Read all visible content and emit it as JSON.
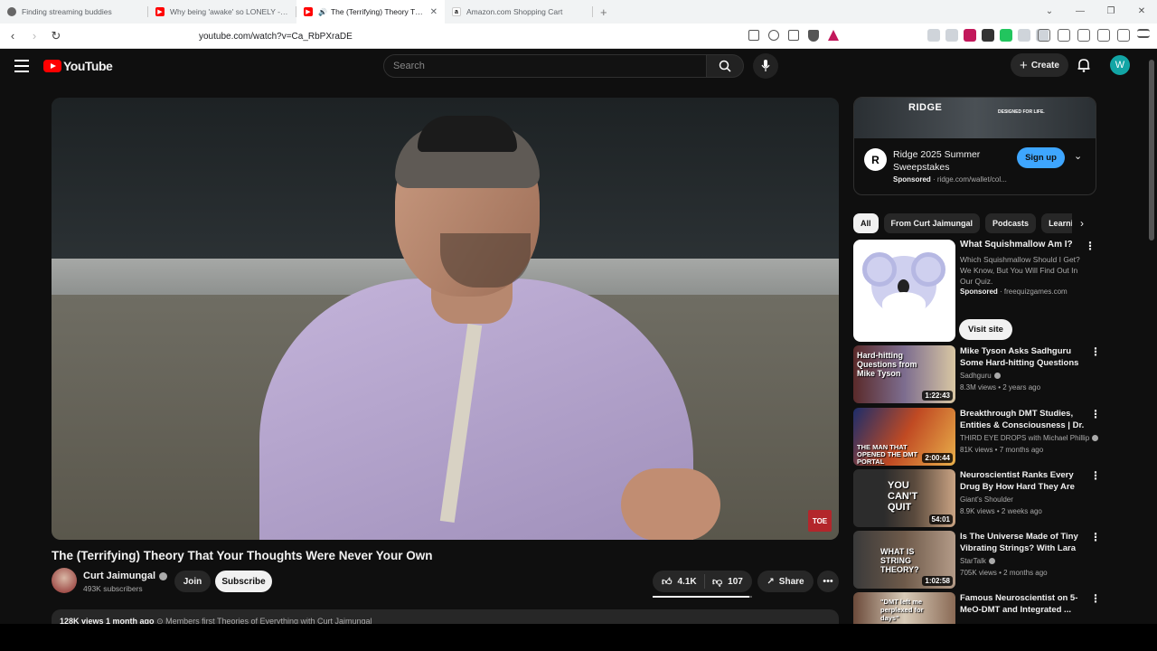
{
  "browser": {
    "tabs": [
      {
        "title": "Finding streaming buddies",
        "icon": "globe-icon",
        "active": false
      },
      {
        "title": "Why being 'awake' so LONELY - YouTube",
        "icon": "youtube-icon",
        "active": false
      },
      {
        "title": "The (Terrifying) Theory That Your Thoughts Were Never Your Own",
        "icon": "youtube-icon",
        "active": true
      },
      {
        "title": "Amazon.com Shopping Cart",
        "icon": "amazon-icon",
        "active": false
      }
    ],
    "url": "youtube.com/watch?v=Ca_RbPXraDE"
  },
  "header": {
    "logo": "YouTube",
    "search_placeholder": "Search",
    "create_label": "Create",
    "avatar_letter": "W"
  },
  "video": {
    "title": "The (Terrifying) Theory That Your Thoughts Were Never Your Own",
    "watermark": "TOE",
    "channel": "Curt Jaimungal",
    "subscribers": "493K subscribers",
    "join_label": "Join",
    "subscribe_label": "Subscribe",
    "likes": "4.1K",
    "dislikes": "107",
    "like_ratio": 0.97,
    "share_label": "Share",
    "description_line": "128K views  1 month ago",
    "description_extra": "Members first  Theories of Everything with Curt Jaimungal"
  },
  "sidebar": {
    "ad": {
      "banner_brand": "RIDGE",
      "banner_tag": "DESIGNED FOR LIFE.",
      "logo_letter": "R",
      "title": "Ridge 2025 Summer Sweepstakes",
      "sponsored_label": "Sponsored",
      "domain": "ridge.com/wallet/col...",
      "signup_label": "Sign up"
    },
    "chips": [
      "All",
      "From Curt Jaimungal",
      "Podcasts",
      "Learning"
    ],
    "sponsored_item": {
      "title": "What Squishmallow Am I?",
      "description": "Which Squishmallow Should I Get? We Know, But You Will Find Out In Our Quiz.",
      "sponsored_label": "Sponsored",
      "domain": "freequizgames.com",
      "visit_label": "Visit site"
    },
    "recommendations": [
      {
        "title": "Mike Tyson Asks Sadhguru Some Hard-hitting Questions",
        "channel": "Sadhguru",
        "verified": true,
        "meta": "8.3M views • 2 years ago",
        "duration": "1:22:43",
        "caption": "Hard-hitting Questions from Mike Tyson"
      },
      {
        "title": "Breakthrough DMT Studies, Entities & Consciousness | Dr. ...",
        "channel": "THIRD EYE DROPS with Michael Phillip",
        "verified": true,
        "meta": "81K views • 7 months ago",
        "duration": "2:00:44",
        "caption": "THE MAN THAT OPENED THE DMT PORTAL"
      },
      {
        "title": "Neuroscientist Ranks Every Drug By How Hard They Are to...",
        "channel": "Giant's Shoulder",
        "verified": false,
        "meta": "8.9K views • 2 weeks ago",
        "duration": "54:01",
        "caption": "YOU CAN'T QUIT"
      },
      {
        "title": "Is The Universe Made of Tiny Vibrating Strings? With Lara ...",
        "channel": "StarTalk",
        "verified": true,
        "meta": "705K views • 2 months ago",
        "duration": "1:02:58",
        "caption": "WHAT IS STRING THEORY?"
      },
      {
        "title": "Famous Neuroscientist on 5-MeO-DMT and Integrated ...",
        "channel": "",
        "verified": false,
        "meta": "",
        "duration": "",
        "caption": "\"DMT left me perplexed for days\""
      }
    ]
  },
  "colors": {
    "accent": "#ff0000",
    "signup": "#3ea6ff",
    "background": "#0f0f0f"
  }
}
